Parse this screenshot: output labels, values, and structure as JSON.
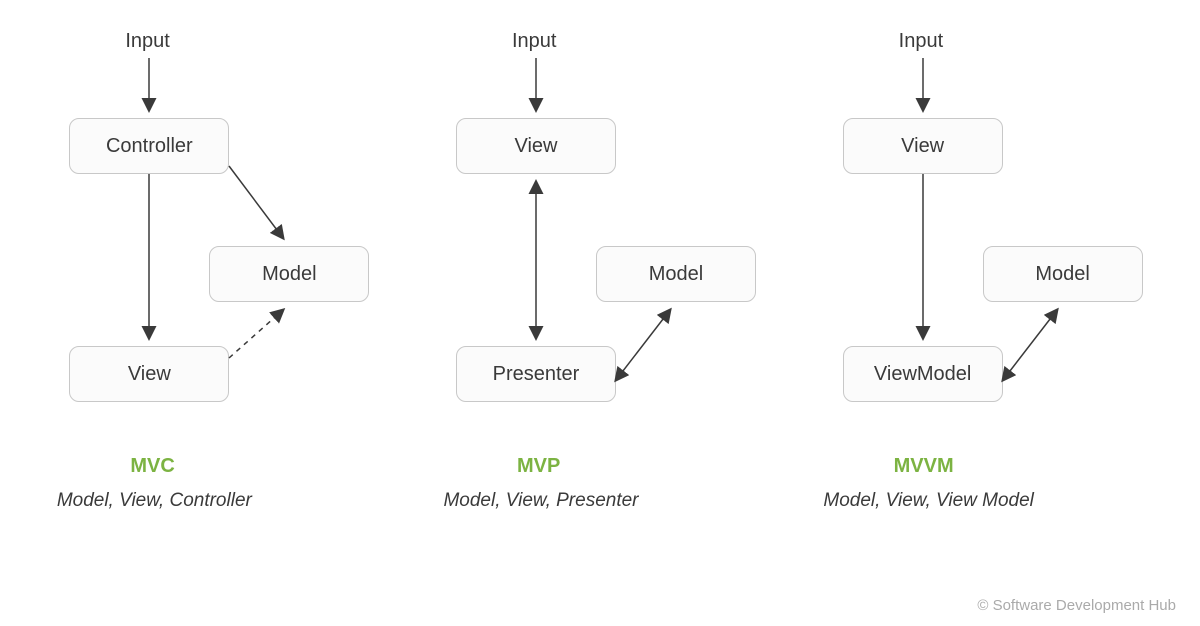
{
  "colors": {
    "accent": "#7cb342",
    "box_border": "#c8c8c8",
    "text": "#3a3a3a",
    "copyright": "#aaaaaa"
  },
  "copyright": "© Software Development Hub",
  "columns": [
    {
      "input": "Input",
      "top_box": "Controller",
      "side_box": "Model",
      "bottom_box": "View",
      "title": "MVC",
      "subtitle": "Model, View, Controller"
    },
    {
      "input": "Input",
      "top_box": "View",
      "side_box": "Model",
      "bottom_box": "Presenter",
      "title": "MVP",
      "subtitle": "Model, View, Presenter"
    },
    {
      "input": "Input",
      "top_box": "View",
      "side_box": "Model",
      "bottom_box": "ViewModel",
      "title": "MVVM",
      "subtitle": "Model, View, View Model"
    }
  ]
}
